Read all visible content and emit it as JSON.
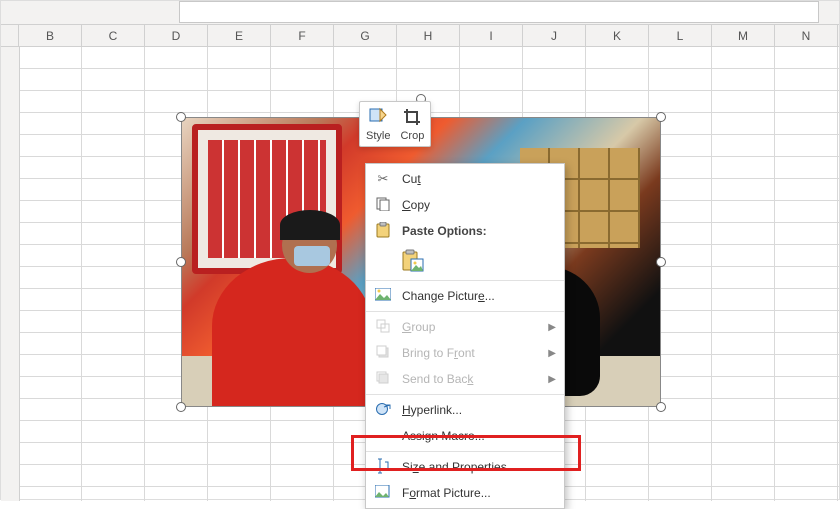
{
  "columns": [
    "B",
    "C",
    "D",
    "E",
    "F",
    "G",
    "H",
    "I",
    "J",
    "K",
    "L",
    "M",
    "N"
  ],
  "mini_toolbar": {
    "style_label": "Style",
    "crop_label": "Crop"
  },
  "context_menu": {
    "cut": "Cut",
    "copy": "Copy",
    "paste_options_header": "Paste Options:",
    "change_picture": "Change Picture...",
    "group": "Group",
    "bring_to_front": "Bring to Front",
    "send_to_back": "Send to Back",
    "hyperlink": "Hyperlink...",
    "assign_macro": "Assign Macro...",
    "size_and_properties": "Size and Properties...",
    "format_picture": "Format Picture..."
  }
}
